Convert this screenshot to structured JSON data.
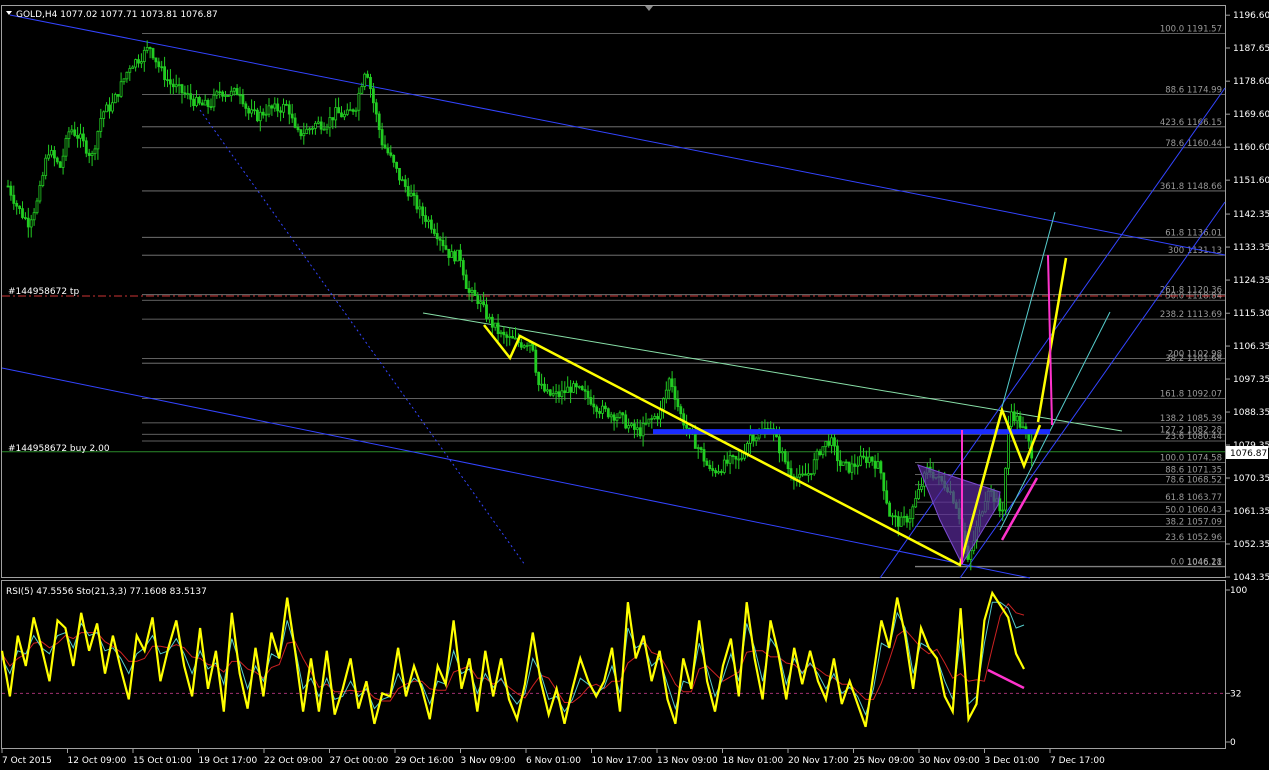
{
  "header": {
    "symbol_line": "GOLD,H4  1077.02 1077.71 1073.81 1076.87",
    "marker_icon": "triangle-down-icon"
  },
  "current_price": "1076.87",
  "order_lines": {
    "tp_label": "#144958672 tp",
    "buy_label": "#144958672 buy 2.00"
  },
  "indicator_header": "RSI(5) 47.5556   Sto(21,3,3) 77.1608 83.5137",
  "colors": {
    "bull": "#22cc22",
    "price_line": "#ffff00",
    "channel": "#3344ff",
    "teal": "#55cccc",
    "magenta": "#ff33cc",
    "grid": "#808080",
    "order": "#cc3333"
  },
  "chart_data": {
    "type": "candlestick",
    "symbol": "GOLD",
    "timeframe": "H4",
    "price_axis": {
      "ylim": [
        1040,
        1197
      ],
      "ticks": [
        "1196.60",
        "1187.65",
        "1178.60",
        "1169.60",
        "1160.60",
        "1151.60",
        "1142.35",
        "1133.35",
        "1124.35",
        "1115.30",
        "1106.35",
        "1097.35",
        "1088.35",
        "1079.35",
        "1070.35",
        "1061.35",
        "1052.35",
        "1043.35"
      ]
    },
    "time_axis": {
      "ticks": [
        "7 Oct 2015",
        "12 Oct 09:00",
        "15 Oct 01:00",
        "19 Oct 17:00",
        "22 Oct 09:00",
        "27 Oct 00:00",
        "29 Oct 16:00",
        "3 Nov 09:00",
        "6 Nov 01:00",
        "10 Nov 17:00",
        "13 Nov 09:00",
        "18 Nov 01:00",
        "20 Nov 17:00",
        "25 Nov 09:00",
        "30 Nov 09:00",
        "3 Dec 01:00",
        "7 Dec 17:00"
      ]
    },
    "close_path": [
      [
        0,
        1150
      ],
      [
        10,
        1144
      ],
      [
        20,
        1140
      ],
      [
        30,
        1146
      ],
      [
        40,
        1160
      ],
      [
        52,
        1155
      ],
      [
        62,
        1166
      ],
      [
        72,
        1163
      ],
      [
        84,
        1158
      ],
      [
        94,
        1170
      ],
      [
        104,
        1172
      ],
      [
        114,
        1178
      ],
      [
        122,
        1183
      ],
      [
        132,
        1185
      ],
      [
        142,
        1188
      ],
      [
        152,
        1182
      ],
      [
        162,
        1178
      ],
      [
        172,
        1176
      ],
      [
        182,
        1174
      ],
      [
        192,
        1172
      ],
      [
        202,
        1172
      ],
      [
        212,
        1176
      ],
      [
        222,
        1175
      ],
      [
        232,
        1176
      ],
      [
        240,
        1170
      ],
      [
        250,
        1169
      ],
      [
        260,
        1171
      ],
      [
        270,
        1171
      ],
      [
        280,
        1172
      ],
      [
        288,
        1164
      ],
      [
        298,
        1165
      ],
      [
        308,
        1167
      ],
      [
        318,
        1167
      ],
      [
        328,
        1170
      ],
      [
        338,
        1169
      ],
      [
        348,
        1172
      ],
      [
        358,
        1183
      ],
      [
        366,
        1172
      ],
      [
        374,
        1162
      ],
      [
        382,
        1158
      ],
      [
        392,
        1152
      ],
      [
        402,
        1148
      ],
      [
        412,
        1143
      ],
      [
        422,
        1140
      ],
      [
        432,
        1136
      ],
      [
        442,
        1131
      ],
      [
        452,
        1131
      ],
      [
        460,
        1121
      ],
      [
        470,
        1119
      ],
      [
        482,
        1113
      ],
      [
        494,
        1109
      ],
      [
        504,
        1108
      ],
      [
        514,
        1107
      ],
      [
        524,
        1108
      ],
      [
        530,
        1096
      ],
      [
        540,
        1093
      ],
      [
        552,
        1093
      ],
      [
        562,
        1095
      ],
      [
        572,
        1094
      ],
      [
        582,
        1092
      ],
      [
        592,
        1089
      ],
      [
        602,
        1088
      ],
      [
        612,
        1087
      ],
      [
        622,
        1084
      ],
      [
        632,
        1083
      ],
      [
        642,
        1086
      ],
      [
        652,
        1088
      ],
      [
        662,
        1098
      ],
      [
        672,
        1088
      ],
      [
        682,
        1082
      ],
      [
        692,
        1078
      ],
      [
        702,
        1072
      ],
      [
        712,
        1073
      ],
      [
        722,
        1075
      ],
      [
        732,
        1075
      ],
      [
        742,
        1082
      ],
      [
        752,
        1082
      ],
      [
        762,
        1085
      ],
      [
        772,
        1078
      ],
      [
        782,
        1072
      ],
      [
        792,
        1070
      ],
      [
        802,
        1072
      ],
      [
        812,
        1078
      ],
      [
        822,
        1081
      ],
      [
        832,
        1074
      ],
      [
        842,
        1073
      ],
      [
        852,
        1075
      ],
      [
        862,
        1076
      ],
      [
        872,
        1073
      ],
      [
        882,
        1060
      ],
      [
        892,
        1058
      ],
      [
        902,
        1060
      ],
      [
        910,
        1066
      ],
      [
        920,
        1073
      ],
      [
        930,
        1070
      ],
      [
        940,
        1068
      ],
      [
        950,
        1062
      ],
      [
        960,
        1047
      ],
      [
        970,
        1058
      ],
      [
        980,
        1068
      ],
      [
        988,
        1064
      ],
      [
        994,
        1060
      ],
      [
        1002,
        1089
      ],
      [
        1010,
        1086
      ],
      [
        1018,
        1082
      ],
      [
        1024,
        1077
      ]
    ],
    "fib_left_levels": [
      {
        "label": "100.0 1191.57",
        "price": 1191.57
      },
      {
        "label": "88.6 1174.99",
        "price": 1174.99
      },
      {
        "label": "423.6 1166.15",
        "price": 1166.15
      },
      {
        "label": "78.6 1160.44",
        "price": 1160.44
      },
      {
        "label": "361.8 1148.66",
        "price": 1148.66
      },
      {
        "label": "61.8 1136.01",
        "price": 1136.01
      },
      {
        "label": "300 1131.13",
        "price": 1131.13
      },
      {
        "label": "261.8 1120.36",
        "price": 1120.36
      },
      {
        "label": "50.0 1118.84",
        "price": 1118.84
      },
      {
        "label": "238.2 1113.69",
        "price": 1113.69
      },
      {
        "label": "200 1102.98",
        "price": 1102.98
      },
      {
        "label": "38.2 1101.68",
        "price": 1101.68
      },
      {
        "label": "161.8 1092.07",
        "price": 1092.07
      },
      {
        "label": "138.2 1085.39",
        "price": 1085.39
      },
      {
        "label": "127.2 1082.28",
        "price": 1082.28
      },
      {
        "label": "23.6 1080.44",
        "price": 1080.44
      }
    ],
    "fib_right_levels": [
      {
        "label": "100.0 1074.58",
        "price": 1074.58
      },
      {
        "label": "88.6 1071.35",
        "price": 1071.35
      },
      {
        "label": "78.6 1068.52",
        "price": 1068.52
      },
      {
        "label": "61.8 1063.77",
        "price": 1063.77
      },
      {
        "label": "50.0 1060.43",
        "price": 1060.43
      },
      {
        "label": "38.2 1057.09",
        "price": 1057.09
      },
      {
        "label": "23.6 1052.96",
        "price": 1052.96
      },
      {
        "label": "0.0 1046.28",
        "price": 1046.28
      },
      {
        "label": "1046.11",
        "price": 1046.11
      }
    ],
    "order_prices": {
      "tp": 1120.0,
      "buy": 1077.5
    },
    "resistance_line": {
      "price": 1083.0
    },
    "rsi_panel": {
      "ylim": [
        0,
        100
      ],
      "ticks": [
        "100",
        "32",
        "0"
      ],
      "level": 32,
      "rsi_values": [
        60,
        30,
        70,
        50,
        82,
        62,
        40,
        80,
        75,
        50,
        85,
        60,
        78,
        45,
        70,
        48,
        28,
        70,
        60,
        82,
        40,
        62,
        80,
        50,
        30,
        75,
        35,
        60,
        20,
        85,
        45,
        22,
        62,
        30,
        72,
        55,
        95,
        60,
        20,
        55,
        20,
        60,
        18,
        35,
        55,
        22,
        40,
        12,
        32,
        30,
        62,
        30,
        50,
        35,
        15,
        50,
        38,
        80,
        35,
        55,
        20,
        60,
        30,
        55,
        28,
        15,
        38,
        72,
        40,
        18,
        35,
        12,
        35,
        55,
        40,
        30,
        40,
        62,
        20,
        92,
        55,
        70,
        40,
        60,
        28,
        12,
        55,
        35,
        80,
        40,
        20,
        50,
        68,
        30,
        92,
        55,
        28,
        80,
        58,
        28,
        62,
        38,
        60,
        40,
        28,
        55,
        25,
        40,
        25,
        10,
        45,
        80,
        62,
        95,
        70,
        35,
        75,
        62,
        55,
        30,
        20,
        88,
        15,
        25,
        80,
        98,
        90,
        82,
        58,
        48
      ],
      "sto_main": [
        55,
        45,
        60,
        58,
        70,
        62,
        58,
        70,
        72,
        62,
        78,
        70,
        72,
        60,
        62,
        55,
        45,
        58,
        62,
        70,
        58,
        60,
        68,
        58,
        45,
        60,
        48,
        52,
        38,
        68,
        52,
        35,
        50,
        40,
        58,
        55,
        80,
        62,
        35,
        42,
        30,
        42,
        28,
        30,
        40,
        30,
        35,
        22,
        28,
        30,
        45,
        35,
        42,
        38,
        25,
        40,
        38,
        60,
        45,
        48,
        32,
        45,
        36,
        42,
        32,
        25,
        32,
        55,
        45,
        28,
        30,
        20,
        28,
        42,
        38,
        32,
        36,
        50,
        32,
        75,
        62,
        65,
        50,
        55,
        38,
        22,
        40,
        38,
        65,
        48,
        30,
        42,
        58,
        40,
        78,
        62,
        40,
        68,
        60,
        38,
        55,
        45,
        52,
        45,
        35,
        45,
        32,
        36,
        30,
        18,
        35,
        65,
        62,
        85,
        75,
        45,
        65,
        62,
        55,
        40,
        28,
        68,
        25,
        30,
        65,
        92,
        92,
        88,
        75,
        77
      ],
      "sto_signal": [
        58,
        50,
        55,
        58,
        65,
        66,
        62,
        65,
        70,
        68,
        72,
        72,
        72,
        66,
        63,
        59,
        53,
        53,
        55,
        63,
        63,
        62,
        64,
        62,
        56,
        55,
        51,
        50,
        46,
        53,
        53,
        48,
        46,
        42,
        49,
        51,
        65,
        66,
        55,
        46,
        36,
        38,
        33,
        33,
        34,
        33,
        34,
        29,
        27,
        27,
        35,
        38,
        40,
        40,
        35,
        34,
        34,
        46,
        48,
        50,
        42,
        42,
        38,
        41,
        36,
        32,
        29,
        37,
        44,
        42,
        34,
        26,
        26,
        30,
        36,
        38,
        35,
        40,
        40,
        52,
        56,
        67,
        59,
        57,
        48,
        38,
        33,
        33,
        48,
        50,
        45,
        40,
        43,
        46,
        59,
        60,
        60,
        56,
        56,
        52,
        51,
        46,
        51,
        48,
        44,
        42,
        38,
        38,
        33,
        28,
        28,
        39,
        54,
        70,
        74,
        68,
        62,
        58,
        61,
        52,
        42,
        45,
        40,
        41,
        40,
        62,
        83,
        91,
        85,
        83.5
      ]
    }
  }
}
